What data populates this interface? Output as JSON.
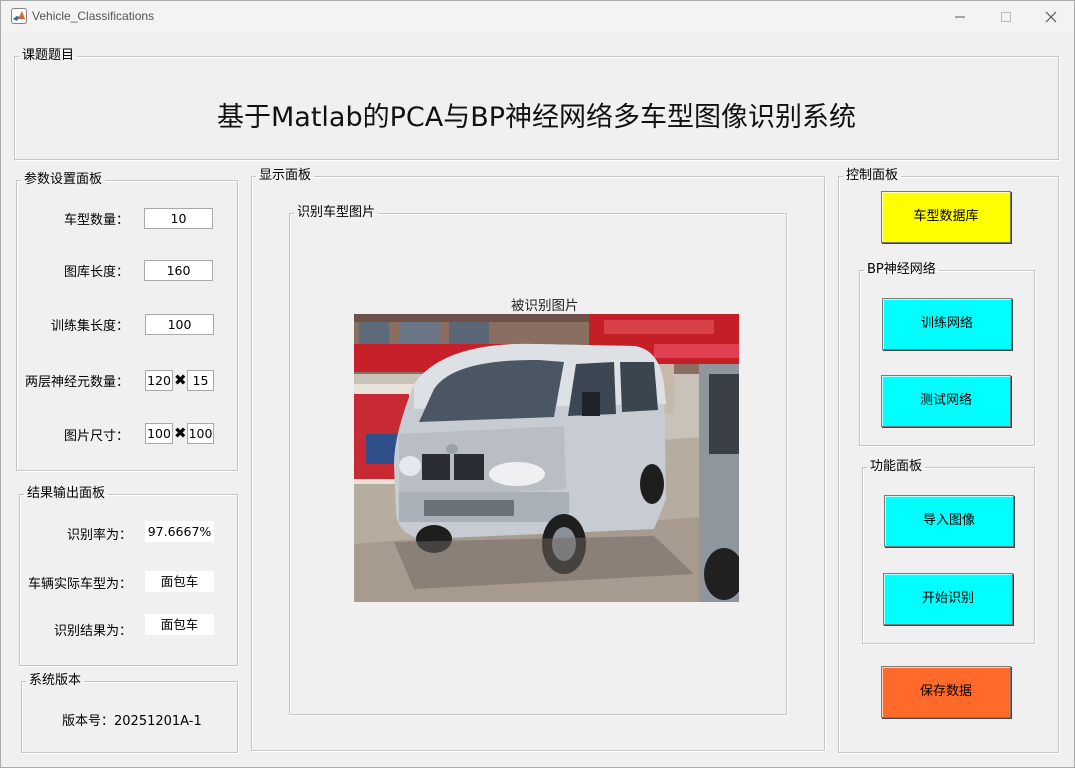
{
  "window": {
    "title": "Vehicle_Classifications",
    "icon": "matlab-icon",
    "controls": [
      "minimize-icon",
      "maximize-icon",
      "close-icon"
    ]
  },
  "topic": {
    "legend": "课题题目",
    "title": "基于Matlab的PCA与BP神经网络多车型图像识别系统"
  },
  "params": {
    "legend": "参数设置面板",
    "vehicle_count_label": "车型数量：",
    "vehicle_count_value": "10",
    "library_length_label": "图库长度：",
    "library_length_value": "160",
    "train_length_label": "训练集长度：",
    "train_length_value": "100",
    "neurons_label": "两层神经元数量：",
    "neurons_layer1": "120",
    "neurons_layer2": "15",
    "image_size_label": "图片尺寸：",
    "image_width": "100",
    "image_height": "100",
    "times": "✖"
  },
  "results": {
    "legend": "结果输出面板",
    "rate_label": "识别率为：",
    "rate_value": "97.6667%",
    "actual_label": "车辆实际车型为：",
    "actual_value": "面包车",
    "result_label": "识别结果为：",
    "result_value": "面包车"
  },
  "version": {
    "legend": "系统版本",
    "text": "版本号：20251201A-1"
  },
  "display": {
    "legend": "显示面板",
    "subpanel_legend": "识别车型图片",
    "image_caption": "被识别图片",
    "image_alt": "white minivan photo"
  },
  "control": {
    "legend": "控制面板",
    "database_button": "车型数据库",
    "bp_legend": "BP神经网络",
    "train_button": "训练网络",
    "test_button": "测试网络",
    "func_legend": "功能面板",
    "import_button": "导入图像",
    "recognize_button": "开始识别",
    "save_button": "保存数据"
  },
  "colors": {
    "database_button": "#ffff00",
    "network_buttons": "#00ffff",
    "save_button": "#ff6a2a",
    "background": "#f0f0f0"
  }
}
